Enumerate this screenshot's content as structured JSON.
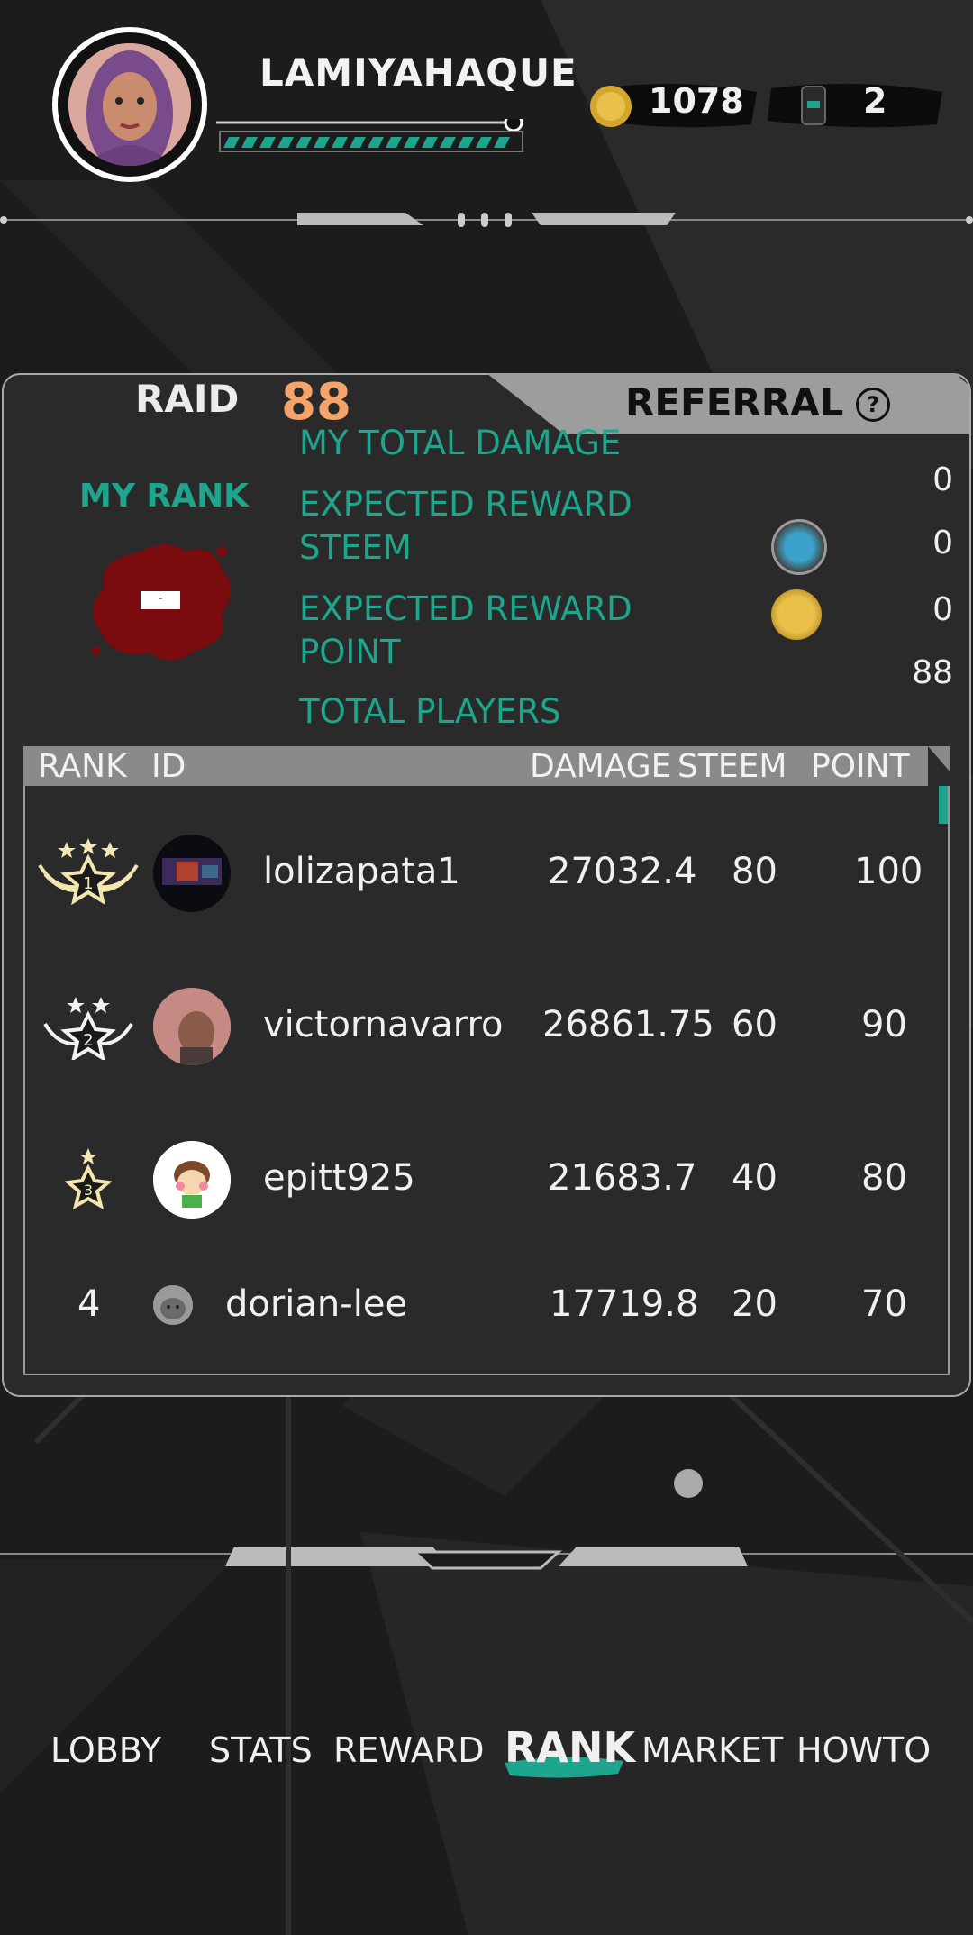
{
  "header": {
    "username": "LAMIYAHAQUE",
    "coins": "1078",
    "keys": "2"
  },
  "tabs": {
    "raid_label": "RAID",
    "raid_count": "88",
    "referral_label": "REFERRAL",
    "help_icon": "?"
  },
  "my_rank": {
    "label": "MY RANK",
    "value": "-"
  },
  "stats": [
    {
      "label": "MY TOTAL DAMAGE",
      "value": "0"
    },
    {
      "label": "EXPECTED REWARD STEEM",
      "value": "0",
      "icon": "steem-icon"
    },
    {
      "label": "EXPECTED REWARD POINT",
      "value": "0",
      "icon": "coin-icon"
    },
    {
      "label": "TOTAL PLAYERS",
      "value": "88"
    }
  ],
  "stat_lines": {
    "steem_line1": "EXPECTED REWARD",
    "steem_line2": "STEEM",
    "point_line1": "EXPECTED REWARD",
    "point_line2": "POINT"
  },
  "table": {
    "headers": [
      "RANK",
      "ID",
      "DAMAGE",
      "STEEM",
      "POINT"
    ],
    "rows": [
      {
        "rank": "1",
        "id": "lolizapata1",
        "damage": "27032.4",
        "steem": "80",
        "point": "100"
      },
      {
        "rank": "2",
        "id": "victornavarro",
        "damage": "26861.75",
        "steem": "60",
        "point": "90"
      },
      {
        "rank": "3",
        "id": "epitt925",
        "damage": "21683.7",
        "steem": "40",
        "point": "80"
      },
      {
        "rank": "4",
        "id": "dorian-lee",
        "damage": "17719.8",
        "steem": "20",
        "point": "70"
      }
    ]
  },
  "nav": {
    "items": [
      "LOBBY",
      "STATS",
      "REWARD",
      "RANK",
      "MARKET",
      "HOWTO"
    ],
    "active": "RANK"
  },
  "colors": {
    "accent": "#1ea58d",
    "raid_count": "#f3a46b",
    "blood": "#7a0b0e"
  }
}
